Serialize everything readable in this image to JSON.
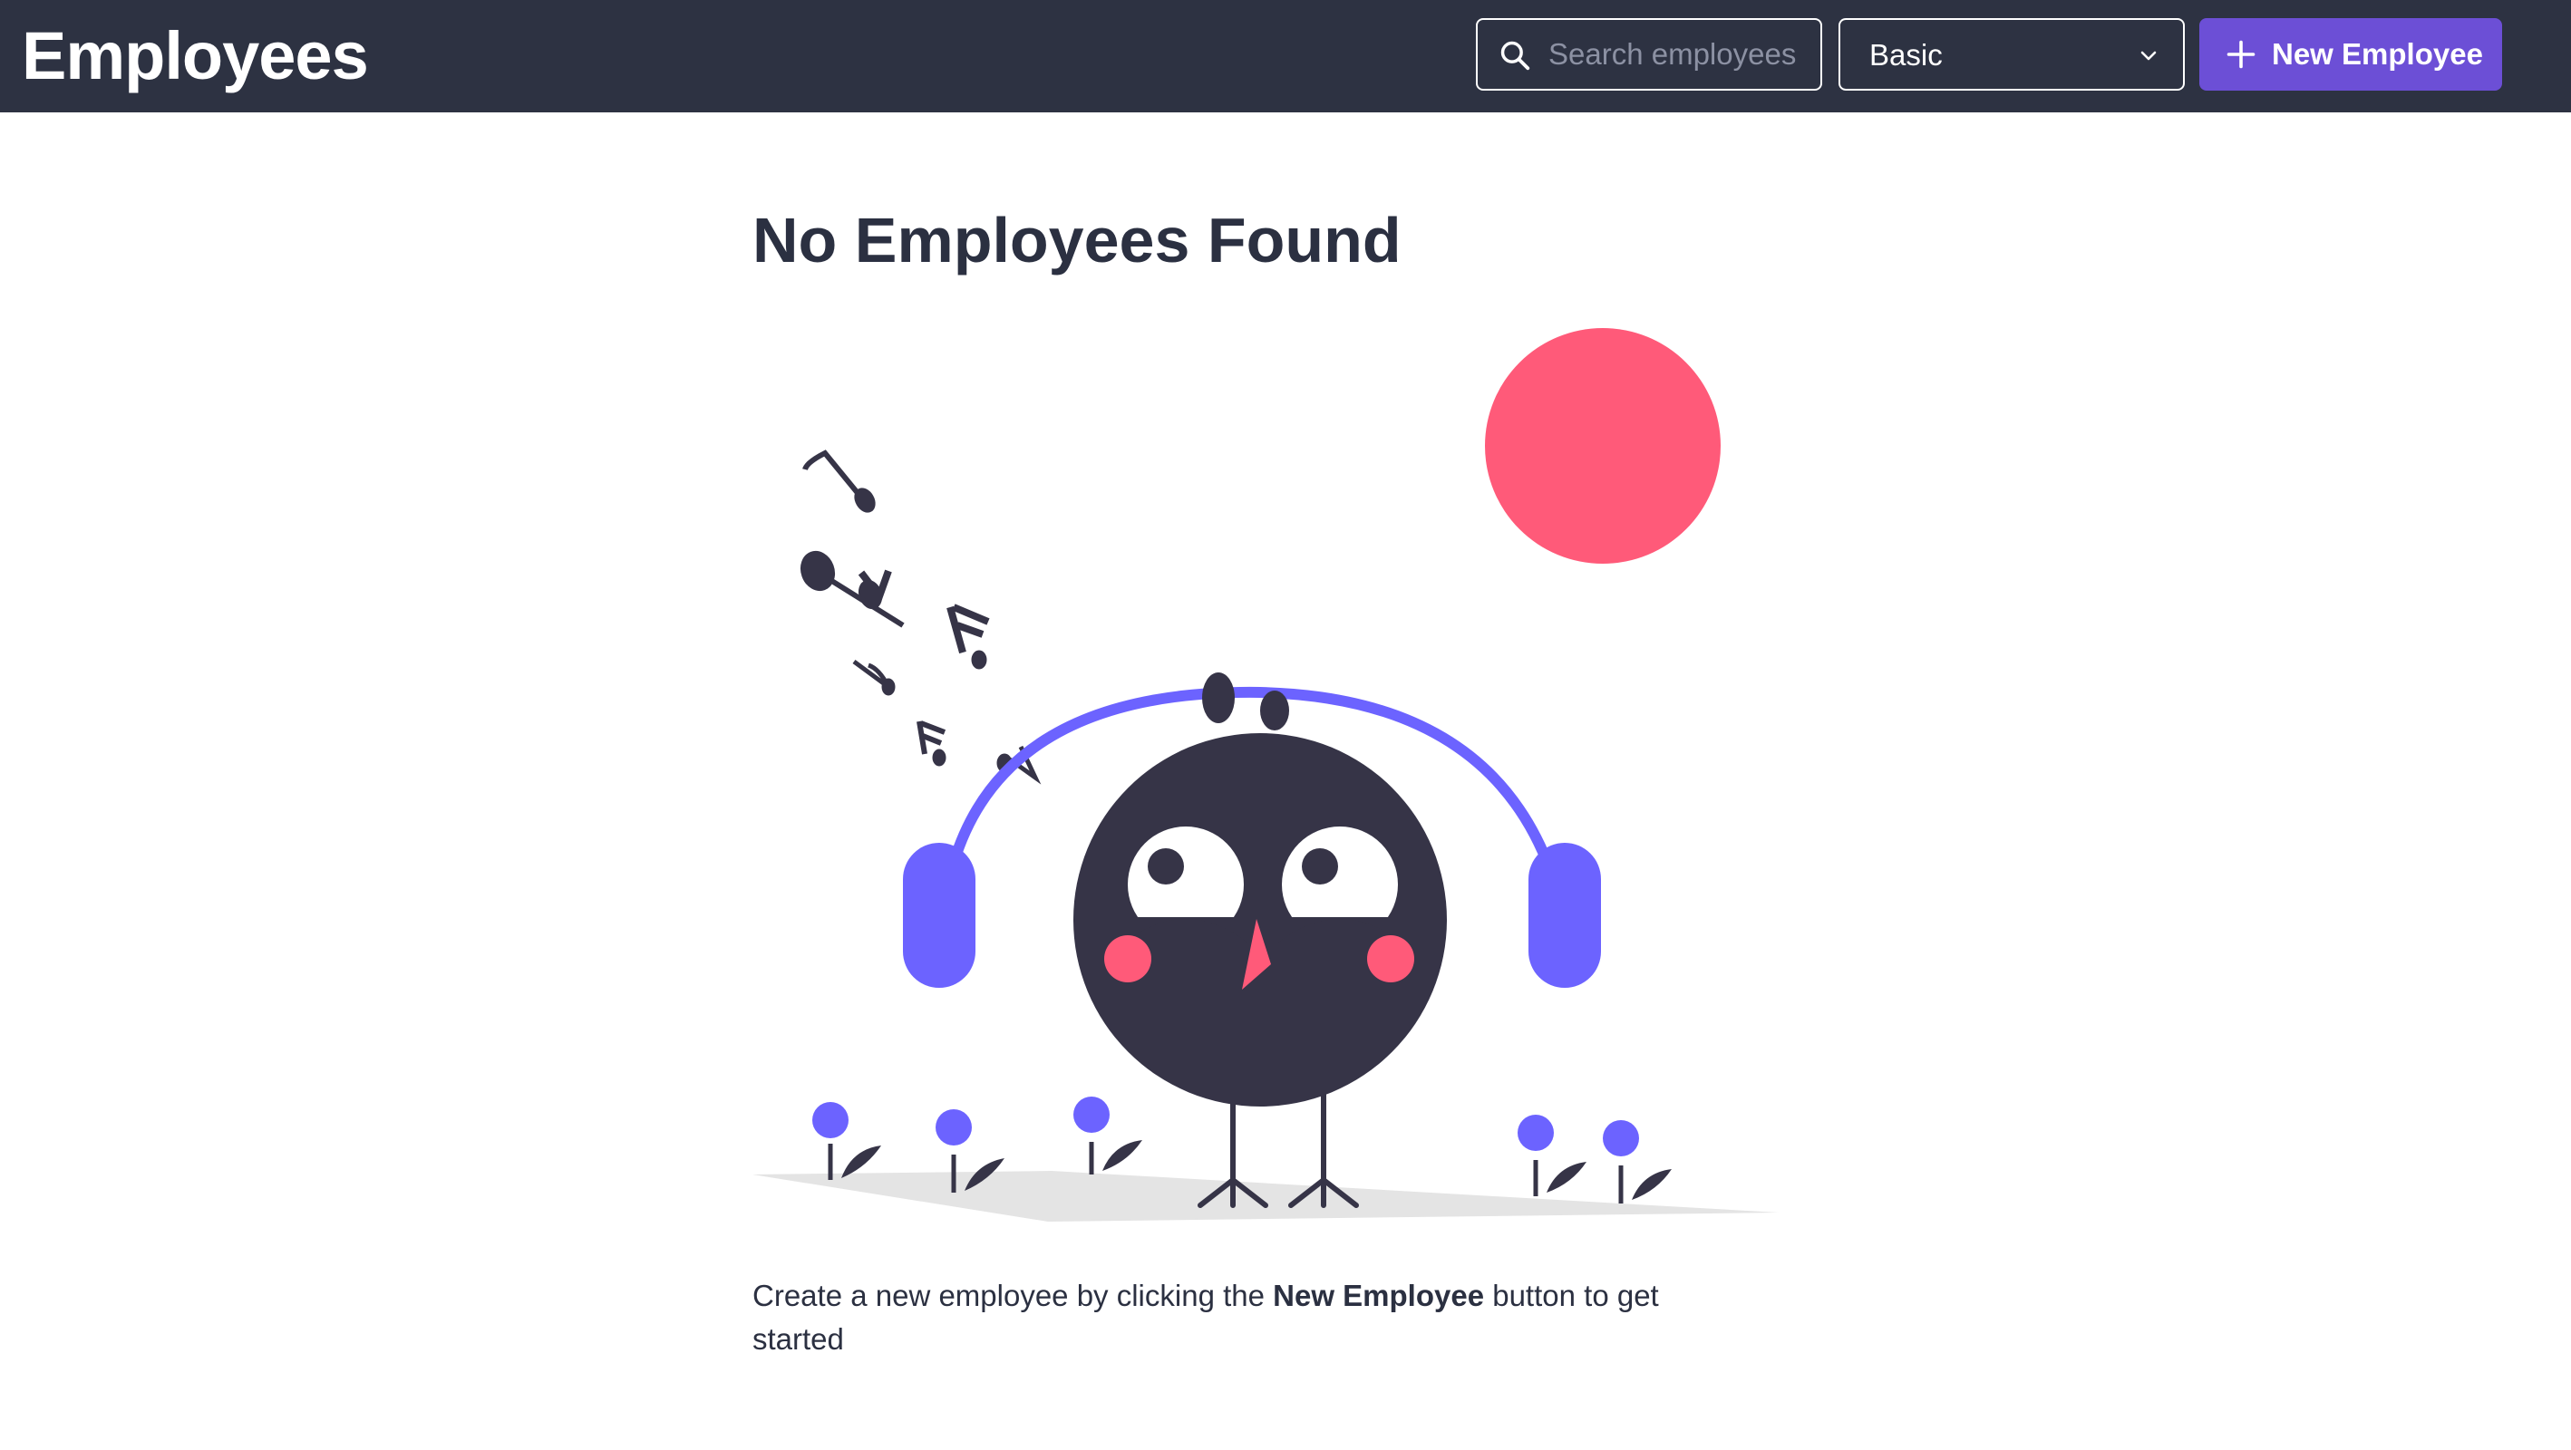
{
  "header": {
    "title": "Employees",
    "search": {
      "placeholder": "Search employees",
      "value": ""
    },
    "view_select": {
      "selected": "Basic"
    },
    "new_button_label": "New Employee"
  },
  "empty_state": {
    "heading": "No Employees Found",
    "message_prefix": "Create a new employee by clicking the ",
    "message_bold": "New Employee",
    "message_suffix": " button to get started"
  },
  "icons": {
    "search": "search-icon",
    "select_chevron": "chevron-down-icon",
    "new_button": "plus-icon"
  },
  "colors": {
    "header_bg": "#2d3242",
    "accent": "#6c4fd6",
    "illustration_purple": "#6c63ff",
    "illustration_pink": "#ff5a79",
    "illustration_dark": "#363447"
  }
}
